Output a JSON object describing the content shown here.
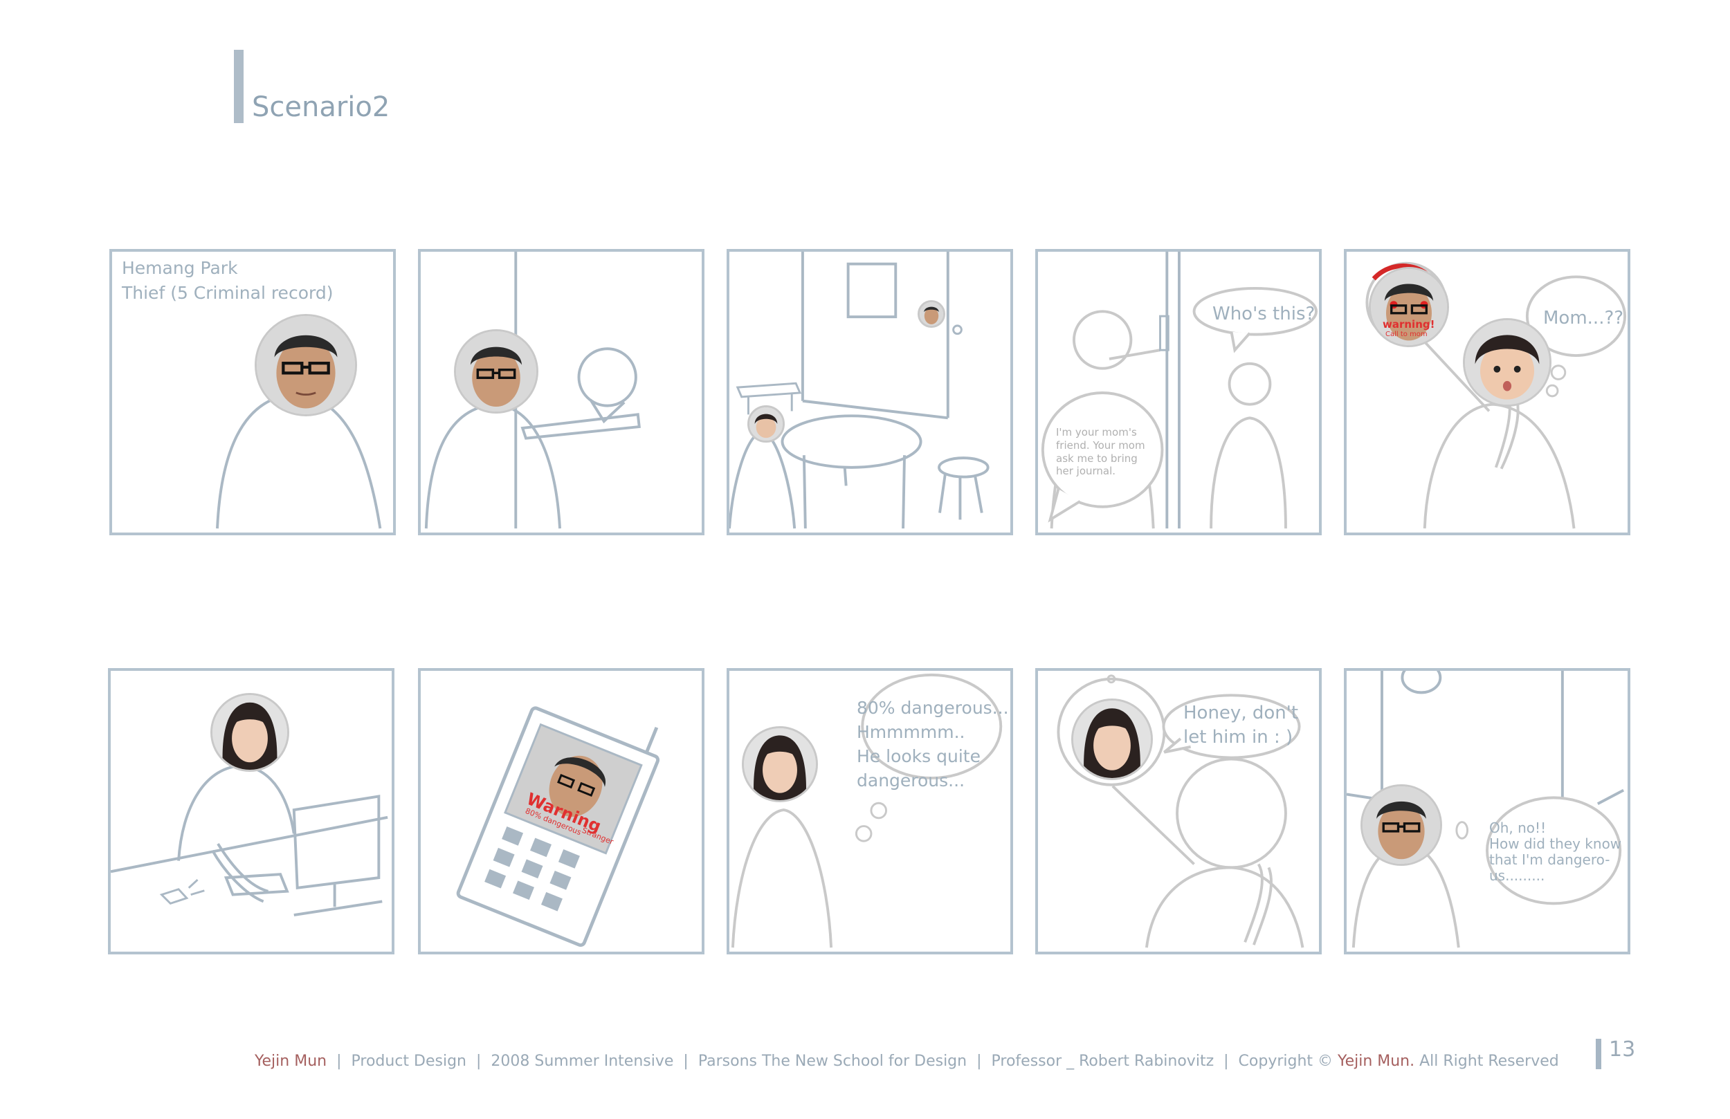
{
  "title": "Scenario2",
  "panels_row1": {
    "p1_caption_line1": "Hemang Park",
    "p1_caption_line2": "Thief (5 Criminal record)",
    "p4_bubble_right": "Who's this?",
    "p4_bubble_left": "I'm your mom's\nfriend. Your mom\nask me to bring\nher journal.",
    "p5_warning_label": "warning!",
    "p5_warning_sub": "Call to mom",
    "p5_bubble": "Mom...??"
  },
  "panels_row2": {
    "p7_phone_warning": "Warning",
    "p7_phone_sub": "80% dangerous",
    "p7_phone_sub2": "Stranger",
    "p8_thought": "80% dangerous...\nHmmmmm..\nHe looks quite\ndangerous...",
    "p9_bubble": "Honey, don't\nlet him in  : )",
    "p10_bubble": "Oh, no!!\nHow did they know\nthat I'm dangero-\nus........."
  },
  "footer": {
    "author": "Yejin Mun",
    "dept": "Product Design",
    "program": "2008 Summer Intensive",
    "school": "Parsons The New School for Design",
    "professor_label": "Professor _",
    "professor_name": "Robert Rabinovitz",
    "copyright_pre": "Copyright ©",
    "copyright_name": "Yejin Mun.",
    "copyright_post": "All Right Reserved",
    "separator": "|"
  },
  "page_number": "13",
  "colors": {
    "panel_border": "#b4c3cf",
    "line_art": "#aab8c4",
    "text_blue": "#9fb0bd",
    "accent_red": "#a5605f",
    "warning_red": "#e03030"
  }
}
